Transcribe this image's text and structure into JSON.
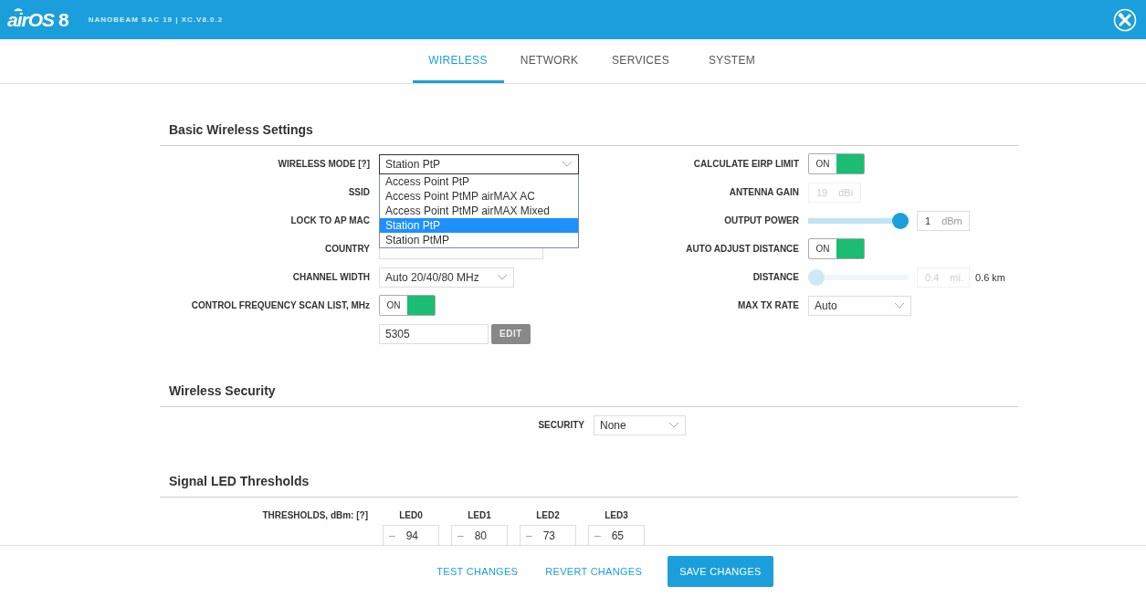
{
  "header": {
    "logo": "airOS",
    "logo_version": "8",
    "device": "NANOBEAM SAC 19 | XC.V8.0.2"
  },
  "tabs": [
    {
      "label": "WIRELESS",
      "selected": true
    },
    {
      "label": "NETWORK",
      "selected": false
    },
    {
      "label": "SERVICES",
      "selected": false
    },
    {
      "label": "SYSTEM",
      "selected": false
    }
  ],
  "basic": {
    "title": "Basic Wireless Settings",
    "left_fields": [
      {
        "kind": "select",
        "label": "WIRELESS MODE [?]",
        "value": "Station PtP",
        "expanded": true,
        "options": [
          {
            "label": "Access Point PtP",
            "selected": false
          },
          {
            "label": "Access Point PtMP airMAX AC",
            "selected": false
          },
          {
            "label": "Access Point PtMP airMAX Mixed",
            "selected": false
          },
          {
            "label": "Station PtP",
            "selected": true
          },
          {
            "label": "Station PtMP",
            "selected": false
          }
        ]
      },
      {
        "kind": "covered",
        "label": "SSID"
      },
      {
        "kind": "covered",
        "label": "LOCK TO AP MAC"
      },
      {
        "kind": "text",
        "label": "COUNTRY"
      },
      {
        "kind": "select",
        "label": "CHANNEL WIDTH",
        "value": "Auto 20/40/80 MHz",
        "expanded": false
      },
      {
        "kind": "toggle",
        "label": "CONTROL FREQUENCY SCAN LIST, MHz",
        "on": true,
        "text": "ON"
      },
      {
        "kind": "edit_list",
        "value": "5305",
        "button": "EDIT"
      }
    ],
    "right_fields": [
      {
        "kind": "toggle",
        "label": "CALCULATE EIRP LIMIT",
        "on": true,
        "text": "ON"
      },
      {
        "kind": "number",
        "label": "ANTENNA GAIN",
        "value": "19",
        "unit": "dBi",
        "disabled": true
      },
      {
        "kind": "slider",
        "label": "OUTPUT POWER",
        "level": 1,
        "value": "1",
        "unit": "dBm",
        "disabled": false
      },
      {
        "kind": "toggle",
        "label": "AUTO ADJUST DISTANCE",
        "on": true,
        "text": "ON"
      },
      {
        "kind": "slider",
        "label": "DISTANCE",
        "level": 0,
        "value": "0.4",
        "unit": "mi.",
        "extra": "0.6 km",
        "disabled": true
      },
      {
        "kind": "select",
        "label": "MAX TX RATE",
        "value": "Auto",
        "expanded": false
      }
    ]
  },
  "security": {
    "title": "Wireless Security",
    "label": "SECURITY",
    "value": "None"
  },
  "led": {
    "title": "Signal LED Thresholds",
    "label": "THRESHOLDS, dBm: [?]",
    "columns": [
      {
        "name": "LED0",
        "sign": "–",
        "value": "94"
      },
      {
        "name": "LED1",
        "sign": "–",
        "value": "80"
      },
      {
        "name": "LED2",
        "sign": "–",
        "value": "73"
      },
      {
        "name": "LED3",
        "sign": "–",
        "value": "65"
      }
    ]
  },
  "footer": {
    "buttons": [
      {
        "label": "TEST CHANGES",
        "kind": "link"
      },
      {
        "label": "REVERT CHANGES",
        "kind": "link"
      },
      {
        "label": "SAVE CHANGES",
        "kind": "primary"
      }
    ]
  }
}
